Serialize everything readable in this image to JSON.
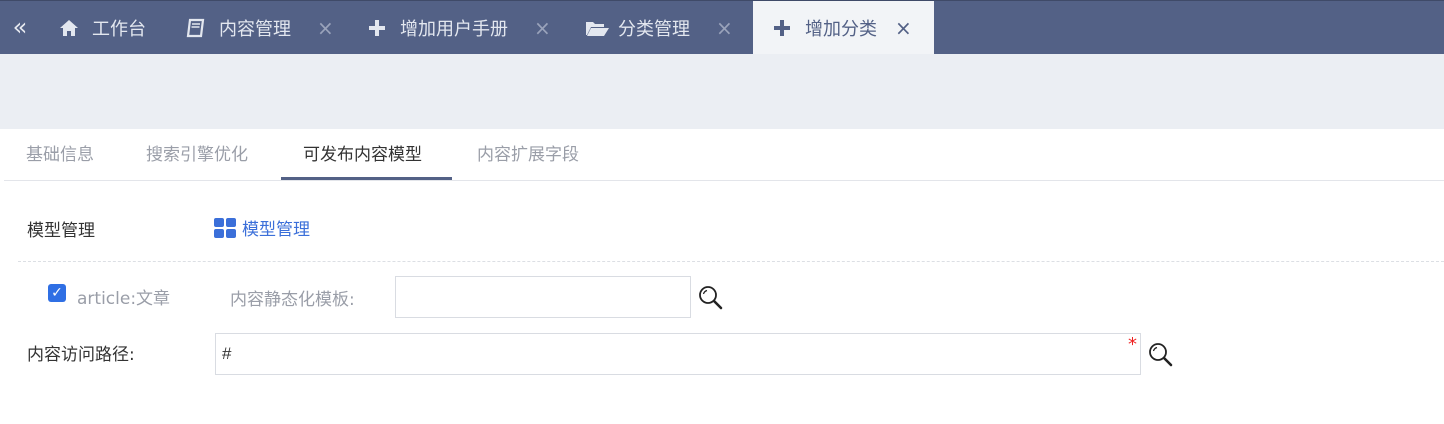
{
  "topbar": {
    "tabs": [
      {
        "label": "工作台",
        "icon": "home-icon",
        "closable": false,
        "active": false
      },
      {
        "label": "内容管理",
        "icon": "book-icon",
        "closable": true,
        "active": false
      },
      {
        "label": "增加用户手册",
        "icon": "plus-icon",
        "closable": true,
        "active": false
      },
      {
        "label": "分类管理",
        "icon": "folder-open-icon",
        "closable": true,
        "active": false
      },
      {
        "label": "增加分类",
        "icon": "plus-icon",
        "closable": true,
        "active": true
      }
    ],
    "collapse_glyph": "«",
    "close_glyph": "×"
  },
  "subtabs": {
    "items": [
      "基础信息",
      "搜索引擎优化",
      "可发布内容模型",
      "内容扩展字段"
    ],
    "active_index": 2
  },
  "form": {
    "model_label": "模型管理",
    "model_link": "模型管理",
    "model_option": "article:文章",
    "model_option_checked": true,
    "static_template_label": "内容静态化模板:",
    "static_template_value": "",
    "access_path_label": "内容访问路径:",
    "access_path_value": "#",
    "required_mark": "*"
  },
  "colors": {
    "topbar": "#536186",
    "active_tab_bg": "#f2f4f7",
    "band": "#ebeef3",
    "link": "#3b6fd9",
    "checkbox": "#2f6fe4",
    "required": "#ee2222"
  }
}
